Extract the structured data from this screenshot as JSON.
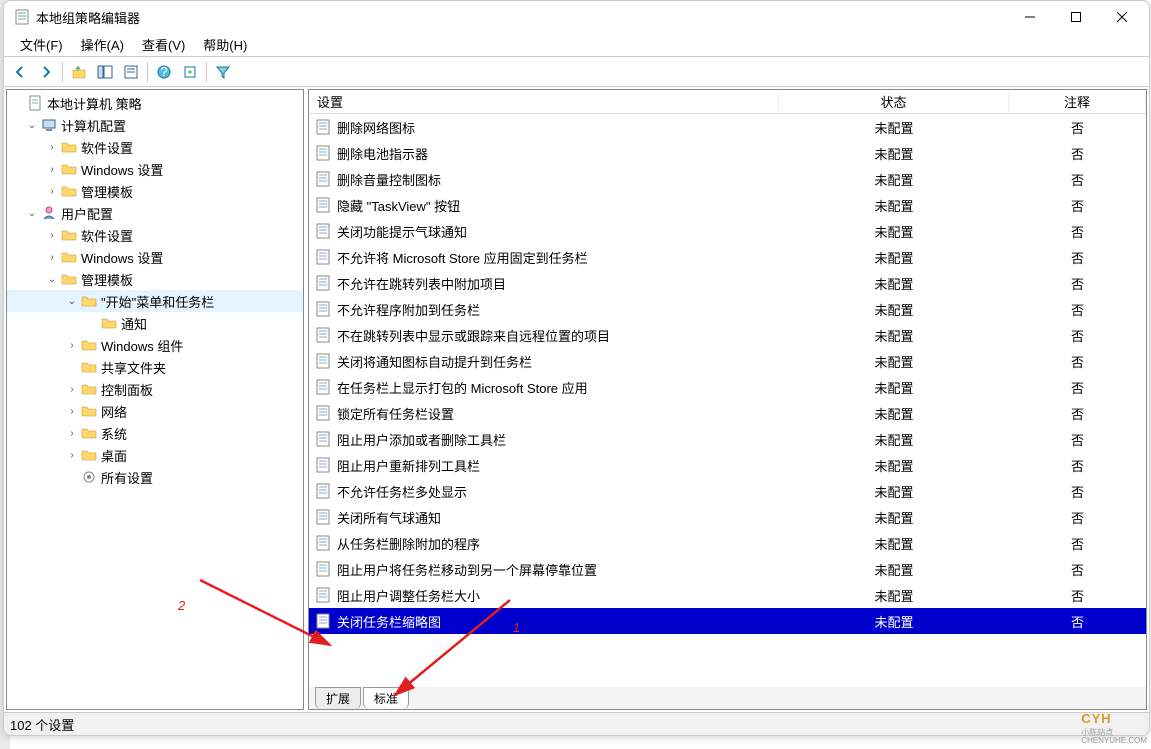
{
  "window": {
    "title": "本地组策略编辑器"
  },
  "menubar": [
    {
      "label": "文件(F)"
    },
    {
      "label": "操作(A)"
    },
    {
      "label": "查看(V)"
    },
    {
      "label": "帮助(H)"
    }
  ],
  "tree": {
    "root": "本地计算机 策略",
    "computer_config": "计算机配置",
    "computer_children": [
      "软件设置",
      "Windows 设置",
      "管理模板"
    ],
    "user_config": "用户配置",
    "user_children_soft": "软件设置",
    "user_children_win": "Windows 设置",
    "admin_templates": "管理模板",
    "start_taskbar": "\"开始\"菜单和任务栏",
    "notifications": "通知",
    "win_components": "Windows 组件",
    "shared_folders": "共享文件夹",
    "control_panel": "控制面板",
    "network": "网络",
    "system": "系统",
    "desktop": "桌面",
    "all_settings": "所有设置"
  },
  "list": {
    "headers": {
      "setting": "设置",
      "state": "状态",
      "comment": "注释"
    },
    "default_state": "未配置",
    "default_comment": "否",
    "rows": [
      {
        "name": "删除网络图标"
      },
      {
        "name": "删除电池指示器"
      },
      {
        "name": "删除音量控制图标"
      },
      {
        "name": "隐藏 \"TaskView\" 按钮"
      },
      {
        "name": "关闭功能提示气球通知"
      },
      {
        "name": "不允许将 Microsoft Store 应用固定到任务栏"
      },
      {
        "name": "不允许在跳转列表中附加项目"
      },
      {
        "name": "不允许程序附加到任务栏"
      },
      {
        "name": "不在跳转列表中显示或跟踪来自远程位置的项目"
      },
      {
        "name": "关闭将通知图标自动提升到任务栏"
      },
      {
        "name": "在任务栏上显示打包的 Microsoft Store 应用"
      },
      {
        "name": "锁定所有任务栏设置"
      },
      {
        "name": "阻止用户添加或者删除工具栏"
      },
      {
        "name": "阻止用户重新排列工具栏"
      },
      {
        "name": "不允许任务栏多处显示"
      },
      {
        "name": "关闭所有气球通知"
      },
      {
        "name": "从任务栏删除附加的程序"
      },
      {
        "name": "阻止用户将任务栏移动到另一个屏幕停靠位置"
      },
      {
        "name": "阻止用户调整任务栏大小"
      },
      {
        "name": "关闭任务栏缩略图",
        "selected": true
      }
    ]
  },
  "tabs": {
    "extended": "扩展",
    "standard": "标准"
  },
  "statusbar": "102 个设置",
  "annotations": {
    "number_2": "2",
    "number_1": "1"
  },
  "watermark": {
    "main": "CYH",
    "sub1": "小陈站点",
    "sub2": "CHENYUHE.COM"
  }
}
